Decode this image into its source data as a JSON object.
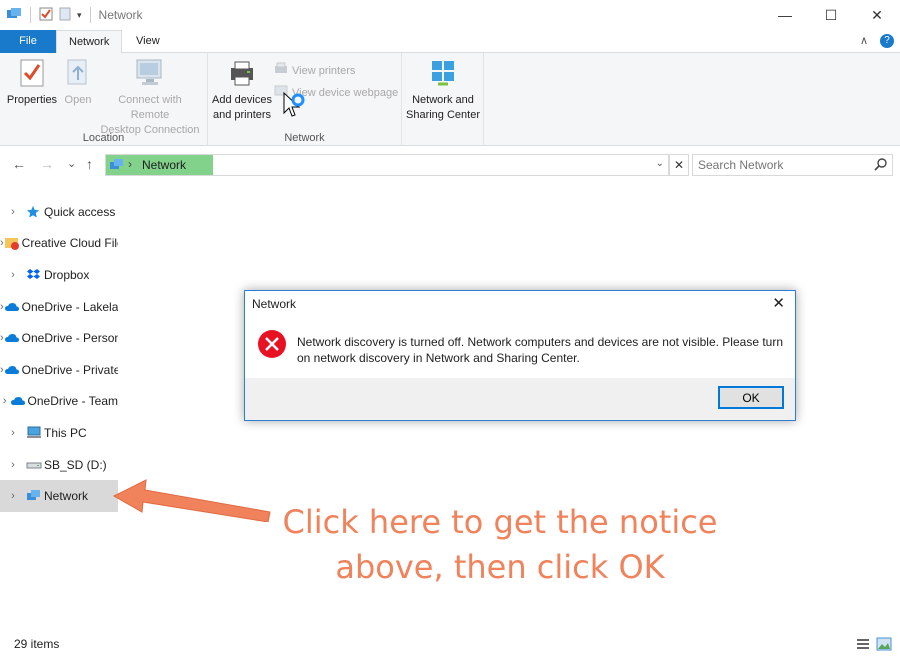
{
  "window": {
    "title": "Network",
    "buttons": {
      "minimize": "—",
      "maximize": "☐",
      "close": "✕"
    }
  },
  "ribbon_tabs": {
    "file": "File",
    "network": "Network",
    "view": "View",
    "collapse_icon": "∧",
    "help_icon": "?"
  },
  "ribbon": {
    "location_group": {
      "label": "Location",
      "properties": "Properties",
      "open": "Open",
      "connect_remote_line1": "Connect with Remote",
      "connect_remote_line2": "Desktop Connection"
    },
    "network_group": {
      "label": "Network",
      "add_devices_line1": "Add devices",
      "add_devices_line2": "and printers",
      "view_printers": "View printers",
      "view_device_webpage": "View device webpage"
    },
    "sharing": {
      "line1": "Network and",
      "line2": "Sharing Center"
    }
  },
  "navigation": {
    "back": "←",
    "forward": "→",
    "recent": "⌄",
    "up": "↑",
    "address_path": "Network",
    "address_dropdown": "⌄",
    "address_clear": "✕",
    "search_placeholder": "Search Network"
  },
  "nav_pane": {
    "items": [
      {
        "label": "Quick access",
        "icon": "star-icon"
      },
      {
        "label": "Creative Cloud Files",
        "icon": "creative-cloud-folder-icon"
      },
      {
        "label": "Dropbox",
        "icon": "dropbox-icon"
      },
      {
        "label": "OneDrive - Lakeland",
        "icon": "onedrive-icon"
      },
      {
        "label": "OneDrive - Personal",
        "icon": "onedrive-icon"
      },
      {
        "label": "OneDrive - Private",
        "icon": "onedrive-icon"
      },
      {
        "label": "OneDrive - Team",
        "icon": "onedrive-icon"
      },
      {
        "label": "This PC",
        "icon": "computer-icon"
      },
      {
        "label": "SB_SD (D:)",
        "icon": "drive-icon"
      },
      {
        "label": "Network",
        "icon": "network-icon",
        "selected": true
      }
    ]
  },
  "status": {
    "item_count": "29 items"
  },
  "dialog": {
    "title": "Network",
    "message": "Network discovery is turned off. Network computers and devices are not visible. Please turn on network discovery in Network and Sharing Center.",
    "ok": "OK",
    "close": "✕"
  },
  "annotation": {
    "line1": "Click here to get the notice",
    "line2": "above, then click OK",
    "color": "#f0825c"
  },
  "colors": {
    "file_tab": "#1979ca",
    "address_highlight": "#82d28c",
    "error_red": "#e81123"
  }
}
